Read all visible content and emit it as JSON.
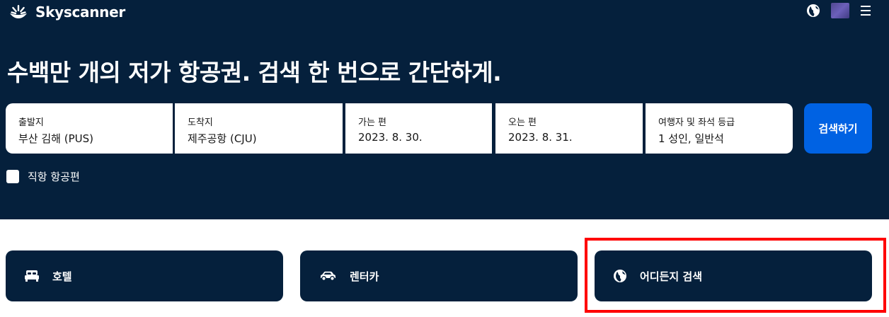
{
  "header": {
    "logo_text": "Skyscanner",
    "logo_icon": "sunrise-icon",
    "globe_icon": "globe-icon",
    "menu_icon": "hamburger-menu-icon"
  },
  "hero": {
    "headline": "수백만 개의 저가 항공권. 검색 한 번으로 간단하게."
  },
  "search_form": {
    "origin": {
      "label": "출발지",
      "value": "부산 김해 (PUS)"
    },
    "destination": {
      "label": "도착지",
      "value": "제주공항 (CJU)"
    },
    "depart": {
      "label": "가는 편",
      "value": "2023. 8. 30."
    },
    "return": {
      "label": "오는 편",
      "value": "2023. 8. 31."
    },
    "travellers": {
      "label": "여행자 및 좌석 등급",
      "value": "1 성인, 일반석"
    },
    "search_button": "검색하기",
    "direct_flights": {
      "label": "직항 항공편",
      "checked": false
    }
  },
  "cards": [
    {
      "label": "호텔",
      "icon": "bed-icon"
    },
    {
      "label": "렌터카",
      "icon": "car-icon"
    },
    {
      "label": "어디든지 검색",
      "icon": "globe-icon"
    }
  ],
  "colors": {
    "navy": "#05203c",
    "blue": "#0062e3",
    "highlight": "#ff0000"
  }
}
